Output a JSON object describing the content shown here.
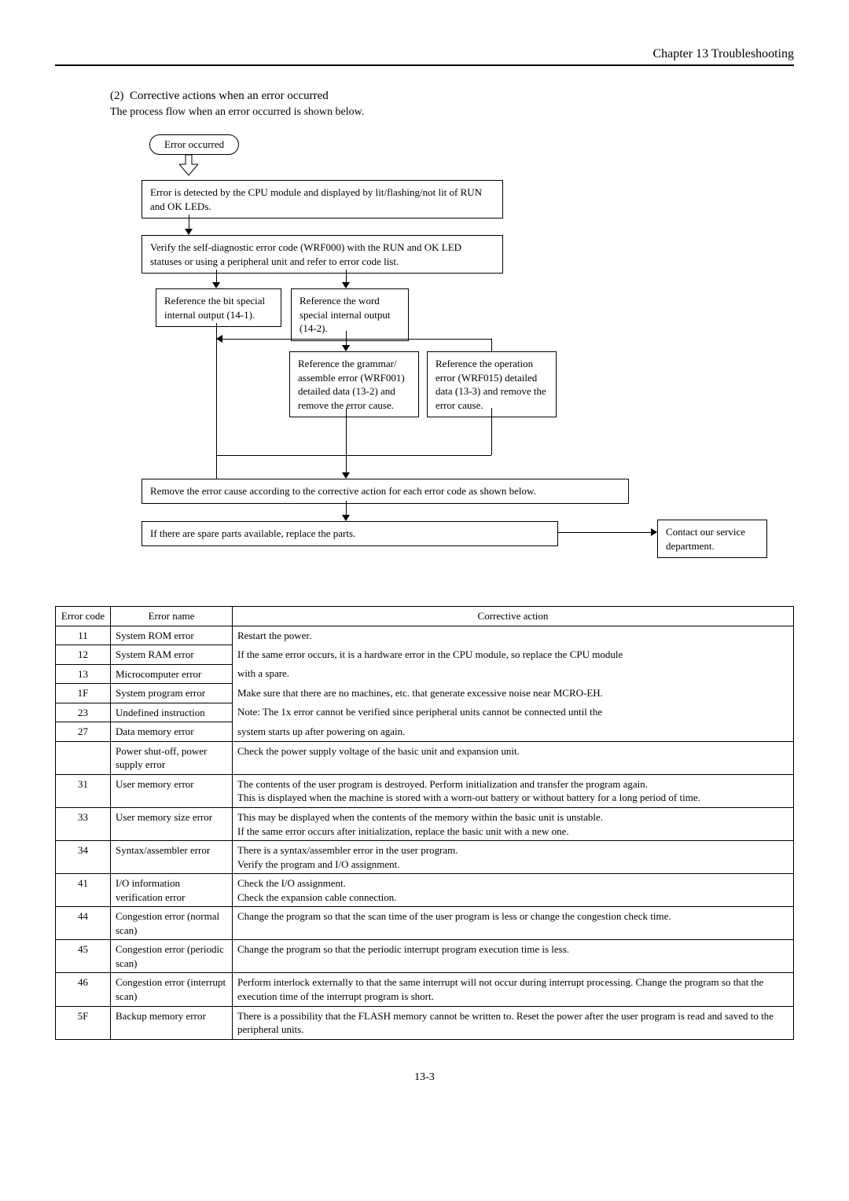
{
  "header": "Chapter 13  Troubleshooting",
  "section": {
    "num": "(2)",
    "title": "Corrective actions when an error occurred",
    "subtitle": "The process flow when an error occurred is shown below."
  },
  "flow": {
    "start": "Error occurred",
    "b1": "Error is detected by the CPU module and displayed by lit/flashing/not lit of RUN and OK LEDs.",
    "b2": "Verify the self-diagnostic error code (WRF000) with the RUN and OK LED statuses or using a peripheral unit and refer to error code list.",
    "b3a": "Reference the bit special internal output (14-1).",
    "b3b": "Reference the word special internal output (14-2).",
    "b4a": "Reference the grammar/ assemble error (WRF001) detailed data (13-2) and remove the error cause.",
    "b4b": "Reference the operation error (WRF015) detailed data (13-3) and remove the error cause.",
    "b5": "Remove the error cause according to the corrective action for each error code as shown below.",
    "b6": "If there are spare parts available, replace the parts.",
    "b7": "Contact our service department."
  },
  "table": {
    "headers": {
      "c1": "Error code",
      "c2": "Error name",
      "c3": "Corrective action"
    },
    "rows": [
      {
        "code": "11",
        "name": "System ROM error",
        "action": "Restart the power."
      },
      {
        "code": "12",
        "name": "System RAM error",
        "action": "If the same error occurs, it is a hardware error in the CPU module, so replace the CPU module"
      },
      {
        "code": "13",
        "name": "Microcomputer error",
        "action": "with a spare."
      },
      {
        "code": "1F",
        "name": "System program error",
        "action": "Make sure that there are no machines, etc. that generate excessive noise near MCRO-EH."
      },
      {
        "code": "23",
        "name": "Undefined instruction",
        "action": "Note:  The 1x error cannot be verified since peripheral units cannot be connected until the"
      },
      {
        "code": "27",
        "name": "Data memory error",
        "action": "           system starts up after powering on again."
      },
      {
        "code": "",
        "name": "Power shut-off, power supply error",
        "action": "Check the power supply voltage of the basic unit and expansion unit."
      },
      {
        "code": "31",
        "name": "User memory error",
        "action": "The contents of the user program is destroyed. Perform initialization and transfer the program again.\nThis is displayed when the machine is stored with a worn-out battery or without battery for a long period of time."
      },
      {
        "code": "33",
        "name": "User memory size error",
        "action": "This may be displayed when the contents of the memory within the basic unit is unstable.\nIf the same error occurs after initialization, replace the basic unit with a new one."
      },
      {
        "code": "34",
        "name": "Syntax/assembler error",
        "action": "There is a syntax/assembler error in the user program.\nVerify the program and I/O assignment."
      },
      {
        "code": "41",
        "name": "I/O information verification error",
        "action": "Check the I/O assignment.\nCheck the expansion cable connection."
      },
      {
        "code": "44",
        "name": "Congestion error (normal scan)",
        "action": "Change the program so that the scan time of the user program is less or change the congestion check time."
      },
      {
        "code": "45",
        "name": "Congestion error (periodic scan)",
        "action": "Change the program so that the periodic interrupt program execution time is less."
      },
      {
        "code": "46",
        "name": "Congestion error (interrupt scan)",
        "action": "Perform interlock externally to that the same interrupt will not occur during interrupt processing. Change the program so that the execution time of the interrupt program is short."
      },
      {
        "code": "5F",
        "name": "Backup memory error",
        "action": "There is a possibility that the FLASH memory cannot be written to. Reset the power after the user program is read and saved to the peripheral units."
      }
    ]
  },
  "footer": "13-3"
}
